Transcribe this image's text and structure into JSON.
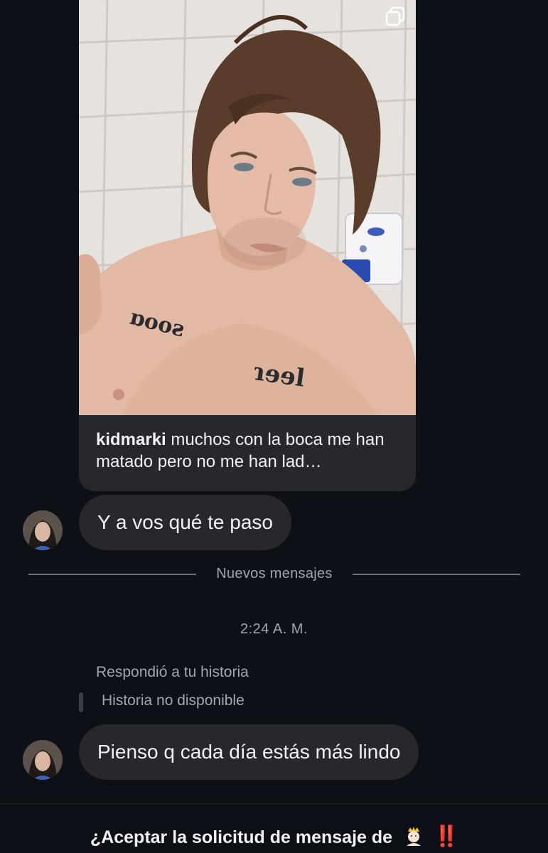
{
  "story": {
    "author": "kidmarki",
    "caption": "muchos con la boca me han matado pero no me han lad…"
  },
  "messages": [
    {
      "sender": "them",
      "text": "Y a vos qué te paso"
    }
  ],
  "divider": {
    "label": "Nuevos mensajes"
  },
  "timestamp": "2:24 A. M.",
  "reply": {
    "label": "Respondió a tu historia",
    "story_status": "Historia no disponible",
    "text": "Pienso q cada día estás más lindo"
  },
  "request": {
    "prompt": "¿Aceptar la solicitud de mensaje de",
    "emoji_icon": "princess-emoji",
    "emphasis": "‼️"
  },
  "colors": {
    "background": "#0d1017",
    "bubble": "#26282e",
    "muted_text": "#a3a6ad",
    "alert_red": "#e5322d"
  }
}
